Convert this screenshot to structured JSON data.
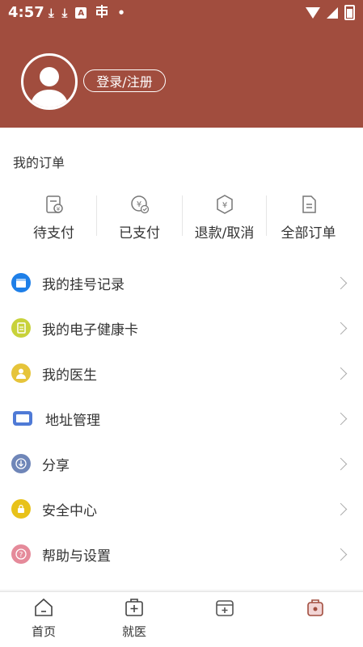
{
  "status_bar": {
    "time": "4:57",
    "icons": [
      "download-icon",
      "download-icon",
      "a-box-icon",
      "notification-icon",
      "dot-icon",
      "wifi-icon",
      "signal-icon",
      "battery-icon"
    ]
  },
  "header": {
    "login_label": "登录/注册",
    "bg_color": "#a14d3e"
  },
  "orders": {
    "title": "我的订单",
    "items": [
      {
        "label": "待支付",
        "icon": "pending-payment-icon"
      },
      {
        "label": "已支付",
        "icon": "paid-icon"
      },
      {
        "label": "退款/取消",
        "icon": "refund-icon"
      },
      {
        "label": "全部订单",
        "icon": "all-orders-icon"
      }
    ]
  },
  "menu": {
    "items": [
      {
        "label": "我的挂号记录",
        "icon": "calendar-icon",
        "color": "#1e7fe8"
      },
      {
        "label": "我的电子健康卡",
        "icon": "card-icon",
        "color": "#c8d23a"
      },
      {
        "label": "我的医生",
        "icon": "doctor-icon",
        "color": "#e6c43a"
      },
      {
        "label": "地址管理",
        "icon": "address-icon",
        "color": "#4f7ad6"
      },
      {
        "label": "分享",
        "icon": "share-icon",
        "color": "#6f86b8"
      },
      {
        "label": "安全中心",
        "icon": "lock-icon",
        "color": "#e8c21a"
      },
      {
        "label": "帮助与设置",
        "icon": "help-icon",
        "color": "#e58a9a"
      }
    ]
  },
  "bottom_nav": {
    "items": [
      {
        "label": "首页",
        "icon": "home-icon"
      },
      {
        "label": "就医",
        "icon": "medical-icon"
      },
      {
        "label": "",
        "icon": "health-kit-icon"
      },
      {
        "label": "",
        "icon": "profile-icon"
      }
    ]
  }
}
